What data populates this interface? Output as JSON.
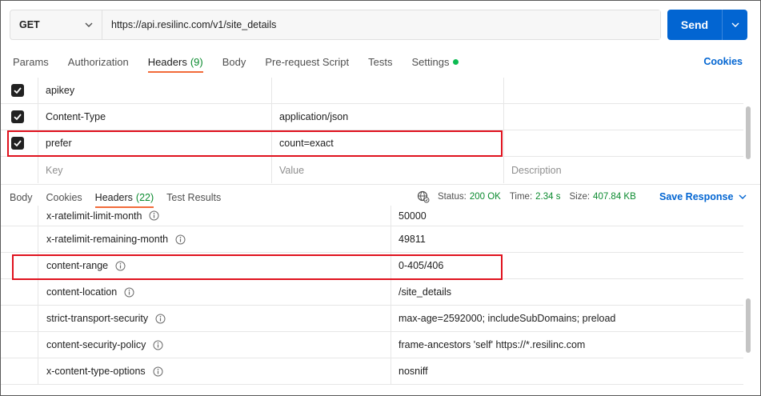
{
  "request": {
    "method": "GET",
    "url": "https://api.resilinc.com/v1/site_details",
    "send_label": "Send"
  },
  "request_tabs": [
    {
      "label": "Params"
    },
    {
      "label": "Authorization"
    },
    {
      "label": "Headers",
      "count": "(9)",
      "active": true
    },
    {
      "label": "Body"
    },
    {
      "label": "Pre-request Script"
    },
    {
      "label": "Tests"
    },
    {
      "label": "Settings"
    }
  ],
  "cookies_label": "Cookies",
  "request_headers": [
    {
      "checked": true,
      "key": "apikey",
      "value": "",
      "description": ""
    },
    {
      "checked": true,
      "key": "Content-Type",
      "value": "application/json",
      "description": ""
    },
    {
      "checked": true,
      "key": "prefer",
      "value": "count=exact",
      "description": ""
    }
  ],
  "placeholders": {
    "key": "Key",
    "value": "Value",
    "description": "Description"
  },
  "response_tabs": [
    {
      "label": "Body"
    },
    {
      "label": "Cookies"
    },
    {
      "label": "Headers",
      "count": "(22)",
      "active": true
    },
    {
      "label": "Test Results"
    }
  ],
  "response_status": {
    "status_label": "Status:",
    "status_value": "200 OK",
    "time_label": "Time:",
    "time_value": "2.34 s",
    "size_label": "Size:",
    "size_value": "407.84 KB"
  },
  "save_response_label": "Save Response",
  "response_headers": [
    {
      "key": "x-ratelimit-limit-month",
      "value": "50000"
    },
    {
      "key": "x-ratelimit-remaining-month",
      "value": "49811"
    },
    {
      "key": "content-range",
      "value": "0-405/406"
    },
    {
      "key": "content-location",
      "value": "/site_details"
    },
    {
      "key": "strict-transport-security",
      "value": "max-age=2592000; includeSubDomains; preload"
    },
    {
      "key": "content-security-policy",
      "value": "frame-ancestors 'self' https://*.resilinc.com"
    },
    {
      "key": "x-content-type-options",
      "value": "nosniff"
    }
  ],
  "colors": {
    "accent": "#0265d2",
    "tab_underline": "#f26b3a",
    "status_ok": "#0a8a2e",
    "highlight": "#e0121e"
  }
}
